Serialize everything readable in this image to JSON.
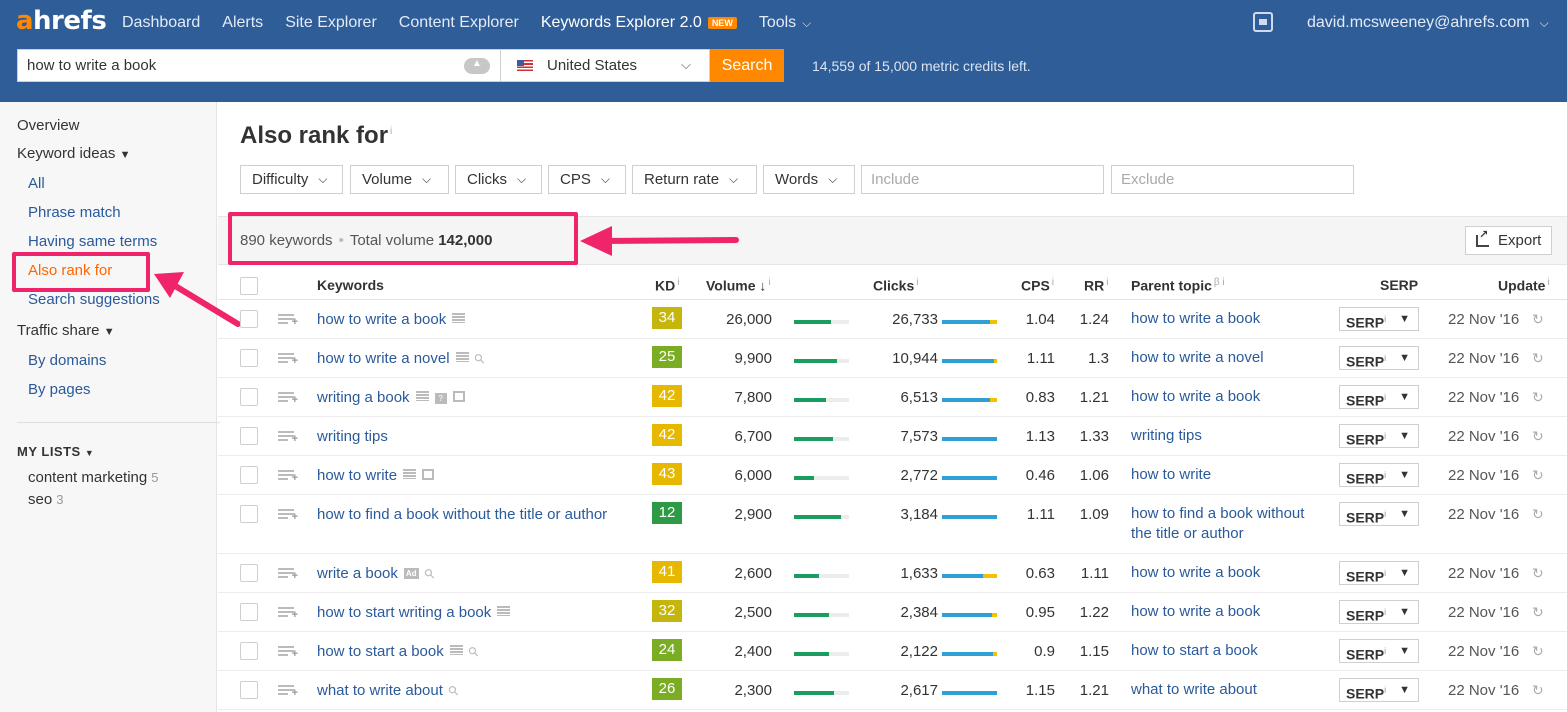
{
  "brand": {
    "logo_a": "a",
    "logo_rest": "hrefs"
  },
  "nav": {
    "items": [
      {
        "label": "Dashboard"
      },
      {
        "label": "Alerts"
      },
      {
        "label": "Site Explorer"
      },
      {
        "label": "Content Explorer"
      },
      {
        "label": "Keywords Explorer 2.0",
        "badge": "NEW",
        "active": true
      },
      {
        "label": "Tools"
      }
    ],
    "user_email": "david.mcsweeney@ahrefs.com"
  },
  "search": {
    "query": "how to write a book",
    "country": "United States",
    "button_label": "Search",
    "credits_text": "14,559 of 15,000 metric credits left."
  },
  "sidebar": {
    "overview": "Overview",
    "keyword_ideas": "Keyword ideas",
    "keyword_ideas_items": [
      "All",
      "Phrase match",
      "Having same terms",
      "Also rank for",
      "Search suggestions"
    ],
    "traffic_share": "Traffic share",
    "traffic_share_items": [
      "By domains",
      "By pages"
    ],
    "my_lists_heading": "MY LISTS",
    "lists": [
      {
        "name": "content marketing",
        "count": "5"
      },
      {
        "name": "seo",
        "count": "3"
      }
    ]
  },
  "main": {
    "title": "Also rank for",
    "filters": [
      "Difficulty",
      "Volume",
      "Clicks",
      "CPS",
      "Return rate",
      "Words"
    ],
    "include_placeholder": "Include",
    "exclude_placeholder": "Exclude",
    "keywords_count": "890 keywords",
    "total_volume_label": "Total volume",
    "total_volume": "142,000",
    "export_label": "Export"
  },
  "table": {
    "headers": {
      "keywords": "Keywords",
      "kd": "KD",
      "volume": "Volume",
      "clicks": "Clicks",
      "cps": "CPS",
      "rr": "RR",
      "parent": "Parent topic",
      "serp": "SERP",
      "update": "Update"
    },
    "serp_btn": "SERP",
    "rows": [
      {
        "keyword": "how to write a book",
        "icons": [
          "serp"
        ],
        "kd": "34",
        "kd_color": "#c5b60d",
        "volume": "26,000",
        "vol_frac": 0.68,
        "clicks": "26,733",
        "clicks_blue": 0.88,
        "clicks_yel": 0.12,
        "cps": "1.04",
        "rr": "1.24",
        "parent": "how to write a book",
        "update": "22 Nov '16"
      },
      {
        "keyword": "how to write a novel",
        "icons": [
          "serp",
          "link"
        ],
        "kd": "25",
        "kd_color": "#7aac24",
        "volume": "9,900",
        "vol_frac": 0.78,
        "clicks": "10,944",
        "clicks_blue": 0.95,
        "clicks_yel": 0.05,
        "cps": "1.11",
        "rr": "1.3",
        "parent": "how to write a novel",
        "update": "22 Nov '16"
      },
      {
        "keyword": "writing a book",
        "icons": [
          "serp",
          "q",
          "img"
        ],
        "kd": "42",
        "kd_color": "#e6b800",
        "volume": "7,800",
        "vol_frac": 0.58,
        "clicks": "6,513",
        "clicks_blue": 0.88,
        "clicks_yel": 0.12,
        "cps": "0.83",
        "rr": "1.21",
        "parent": "how to write a book",
        "update": "22 Nov '16"
      },
      {
        "keyword": "writing tips",
        "icons": [],
        "kd": "42",
        "kd_color": "#e6b800",
        "volume": "6,700",
        "vol_frac": 0.7,
        "clicks": "7,573",
        "clicks_blue": 1.0,
        "clicks_yel": 0,
        "cps": "1.13",
        "rr": "1.33",
        "parent": "writing tips",
        "update": "22 Nov '16"
      },
      {
        "keyword": "how to write",
        "icons": [
          "serp",
          "img"
        ],
        "kd": "43",
        "kd_color": "#e6b800",
        "volume": "6,000",
        "vol_frac": 0.36,
        "clicks": "2,772",
        "clicks_blue": 1.0,
        "clicks_yel": 0,
        "cps": "0.46",
        "rr": "1.06",
        "parent": "how to write",
        "update": "22 Nov '16"
      },
      {
        "keyword": "how to find a book without the title or author",
        "icons": [],
        "kd": "12",
        "kd_color": "#2f9a45",
        "volume": "2,900",
        "vol_frac": 0.86,
        "clicks": "3,184",
        "clicks_blue": 1.0,
        "clicks_yel": 0,
        "cps": "1.11",
        "rr": "1.09",
        "parent": "how to find a book without",
        "parent2": "the title or author",
        "update": "22 Nov '16"
      },
      {
        "keyword": "write a book",
        "icons": [
          "ad",
          "link"
        ],
        "kd": "41",
        "kd_color": "#e6b800",
        "volume": "2,600",
        "vol_frac": 0.46,
        "clicks": "1,633",
        "clicks_blue": 0.75,
        "clicks_yel": 0.25,
        "cps": "0.63",
        "rr": "1.11",
        "parent": "how to write a book",
        "update": "22 Nov '16"
      },
      {
        "keyword": "how to start writing a book",
        "icons": [
          "serp"
        ],
        "kd": "32",
        "kd_color": "#c5b60d",
        "volume": "2,500",
        "vol_frac": 0.64,
        "clicks": "2,384",
        "clicks_blue": 0.9,
        "clicks_yel": 0.1,
        "cps": "0.95",
        "rr": "1.22",
        "parent": "how to write a book",
        "update": "22 Nov '16"
      },
      {
        "keyword": "how to start a book",
        "icons": [
          "serp",
          "link"
        ],
        "kd": "24",
        "kd_color": "#7aac24",
        "volume": "2,400",
        "vol_frac": 0.64,
        "clicks": "2,122",
        "clicks_blue": 0.93,
        "clicks_yel": 0.07,
        "cps": "0.9",
        "rr": "1.15",
        "parent": "how to start a book",
        "update": "22 Nov '16"
      },
      {
        "keyword": "what to write about",
        "icons": [
          "link"
        ],
        "kd": "26",
        "kd_color": "#7aac24",
        "volume": "2,300",
        "vol_frac": 0.72,
        "clicks": "2,617",
        "clicks_blue": 1.0,
        "clicks_yel": 0,
        "cps": "1.15",
        "rr": "1.21",
        "parent": "what to write about",
        "update": "22 Nov '16"
      }
    ]
  },
  "colors": {
    "topbar": "#2f5d98",
    "accent": "#ff8800",
    "highlight": "#f0246a",
    "link": "#2a5a9a"
  }
}
